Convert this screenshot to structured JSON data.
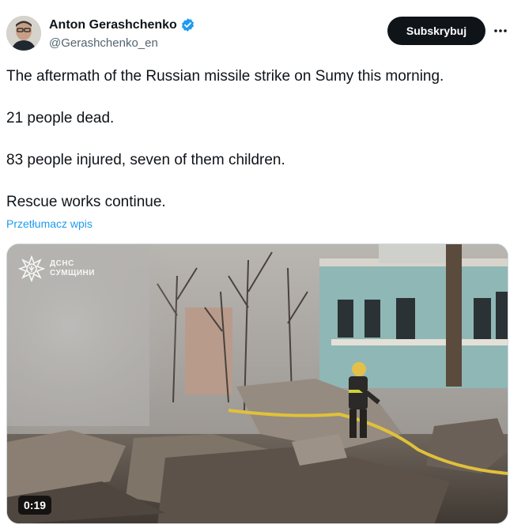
{
  "author": {
    "display_name": "Anton Gerashchenko",
    "handle": "@Gerashchenko_en",
    "verified_icon": "verified-badge-icon",
    "verified_color": "#1d9bf0"
  },
  "actions": {
    "subscribe_label": "Subskrybuj",
    "more_icon": "more-horizontal-icon"
  },
  "tweet": {
    "paragraphs": [
      "The aftermath of the Russian missile strike on Sumy this morning.",
      "21 people dead.",
      "83 people injured, seven of them children.",
      "Rescue works continue."
    ],
    "translate_label": "Przetłumacz wpis"
  },
  "media": {
    "watermark_line1": "ДСНС",
    "watermark_line2": "СУМЩИНИ",
    "duration": "0:19"
  },
  "colors": {
    "accent": "#1d9bf0",
    "text": "#0f1419",
    "secondary": "#536471"
  }
}
